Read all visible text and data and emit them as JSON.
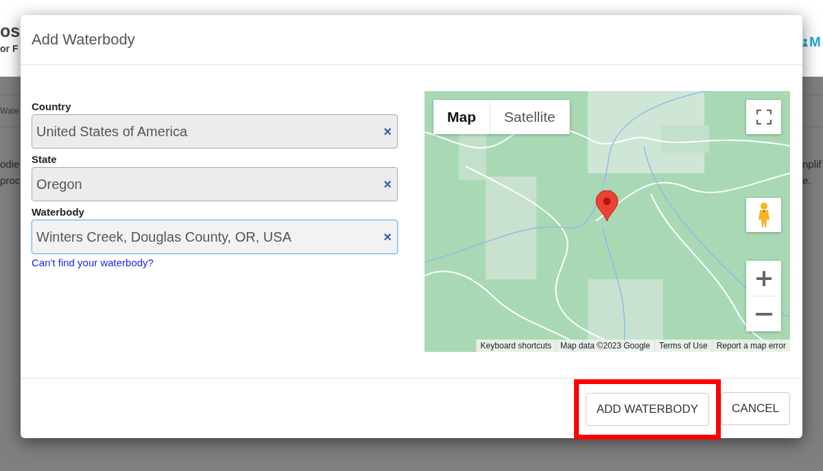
{
  "background": {
    "header_left": [
      "os",
      "or F"
    ],
    "header_right": "M",
    "tab_fragment": "Wate",
    "text_left": [
      "odie",
      "proc"
    ],
    "text_right": [
      "nplif",
      "e."
    ]
  },
  "dialog": {
    "title": "Add Waterbody",
    "fields": [
      {
        "label": "Country",
        "value": "United States of America",
        "clear": "×",
        "focused": false
      },
      {
        "label": "State",
        "value": "Oregon",
        "clear": "×",
        "focused": false
      },
      {
        "label": "Waterbody",
        "value": "Winters Creek, Douglas County, OR, USA",
        "clear": "×",
        "focused": true
      }
    ],
    "help_link": "Can't find your waterbody?",
    "map": {
      "map_types": [
        {
          "label": "Map",
          "selected": true
        },
        {
          "label": "Satellite",
          "selected": false
        }
      ],
      "attribution": [
        "Keyboard shortcuts",
        "Map data ©2023 Google",
        "Terms of Use",
        "Report a map error"
      ]
    },
    "buttons": [
      {
        "label": "ADD WATERBODY",
        "highlighted": true
      },
      {
        "label": "CANCEL",
        "highlighted": false
      }
    ]
  }
}
